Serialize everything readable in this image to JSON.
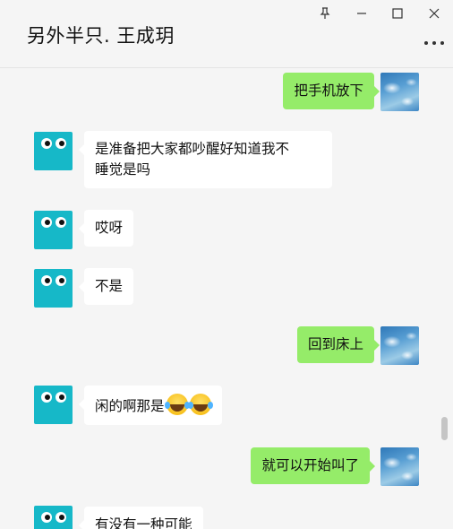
{
  "window": {
    "title": "另外半只. 王成玥"
  },
  "messages": [
    {
      "side": "right",
      "text": "把手机放下"
    },
    {
      "side": "left",
      "line1": "是准备把大家都吵醒好知道我不",
      "line2": "睡觉是吗"
    },
    {
      "side": "left",
      "text": "哎呀"
    },
    {
      "side": "left",
      "text": "不是"
    },
    {
      "side": "right",
      "text": "回到床上"
    },
    {
      "side": "left",
      "text": "闲的啊那是",
      "emoji": "laughing-tears-emoji"
    },
    {
      "side": "right",
      "text": "就可以开始叫了"
    },
    {
      "side": "left",
      "text": "有没有一种可能"
    }
  ],
  "icons": {
    "pin": "pin-icon",
    "minimize": "minimize-icon",
    "maximize": "maximize-icon",
    "close": "close-icon",
    "more": "more-icon"
  },
  "colors": {
    "self_bubble": "#95ec69",
    "other_bubble": "#ffffff",
    "background": "#f5f5f5",
    "avatar_other": "#16b8c8"
  }
}
